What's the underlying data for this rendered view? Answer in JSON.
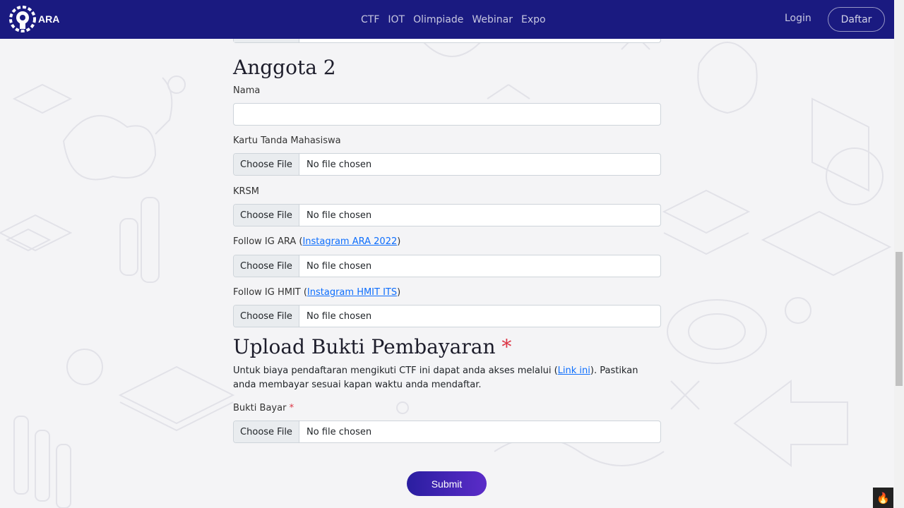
{
  "nav": {
    "brand": "ARA",
    "links": [
      "CTF",
      "IOT",
      "Olimpiade",
      "Webinar",
      "Expo"
    ],
    "login": "Login",
    "daftar": "Daftar"
  },
  "anggota2": {
    "heading": "Anggota 2",
    "nama_label": "Nama",
    "nama_value": "",
    "ktm_label": "Kartu Tanda Mahasiswa",
    "krsm_label": "KRSM",
    "ig_ara_prefix": "Follow IG ARA (",
    "ig_ara_link": "Instagram ARA 2022",
    "ig_ara_suffix": ")",
    "ig_hmit_prefix": "Follow IG HMIT (",
    "ig_hmit_link": "Instagram HMIT ITS",
    "ig_hmit_suffix": ")"
  },
  "file_input": {
    "button": "Choose File",
    "status": "No file chosen"
  },
  "payment": {
    "heading": "Upload Bukti Pembayaran",
    "required_mark": "*",
    "para_prefix": "Untuk biaya pendaftaran mengikuti CTF ini dapat anda akses melalui (",
    "para_link": "Link ini",
    "para_suffix": "). Pastikan anda membayar sesuai kapan waktu anda mendaftar.",
    "bukti_label": "Bukti Bayar"
  },
  "submit_label": "Submit",
  "colors": {
    "navbar": "#1a1a80",
    "required": "#dc3545",
    "link": "#0d6efd",
    "submit_start": "#2a1ea0",
    "submit_end": "#5b2cc8"
  },
  "icons": {
    "logo": "ara-gear-bulb-logo",
    "corner": "flame-icon"
  }
}
